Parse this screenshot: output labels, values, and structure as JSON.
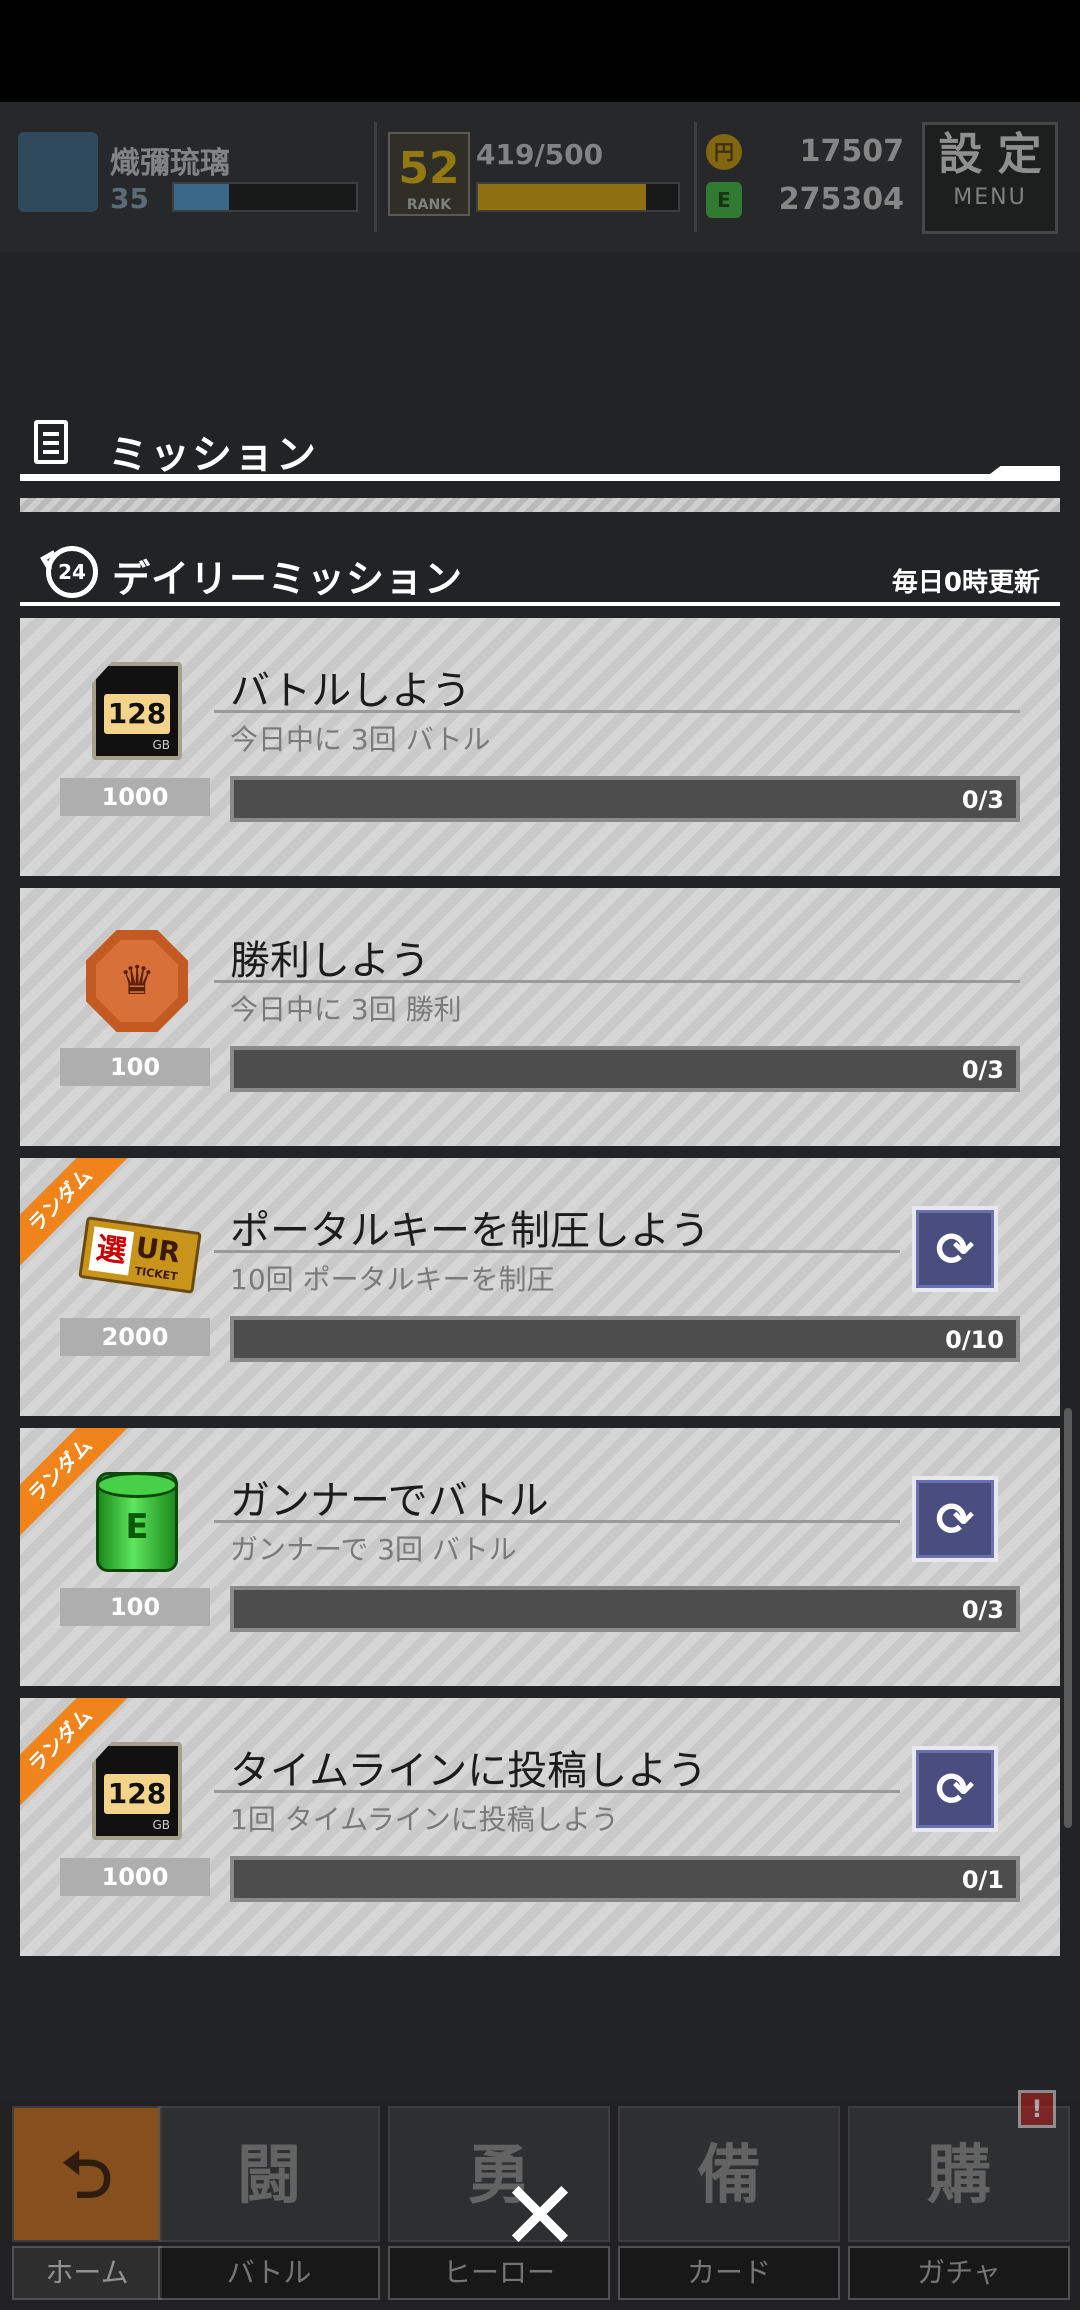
{
  "header": {
    "player_name": "熾彌琉璃",
    "level": "35",
    "level_progress": 0.3,
    "rank": "52",
    "rank_label": "RANK",
    "exp": "419/500",
    "exp_progress": 0.838,
    "gold_coins": "17507",
    "green_coins": "275304",
    "menu_kanji": "設 定",
    "menu_label": "MENU",
    "gold_icon_glyph": "円",
    "green_icon_glyph": "E"
  },
  "mission_panel": {
    "title": "ミッション",
    "section_title": "デイリーミッション",
    "section_icon_text": "24",
    "reset_note": "毎日0時更新"
  },
  "missions": [
    {
      "title": "バトルしよう",
      "description": "今日中に 3回 バトル",
      "reward_icon": "memory-128gb-icon",
      "reward_icon_text": "128",
      "reward_icon_sub": "GB",
      "reward_count": "1000",
      "progress_text": "0/3",
      "progress": 0,
      "random": false
    },
    {
      "title": "勝利しよう",
      "description": "今日中に 3回 勝利",
      "reward_icon": "bronze-medal-icon",
      "reward_icon_text": "♛",
      "reward_count": "100",
      "progress_text": "0/3",
      "progress": 0,
      "random": false
    },
    {
      "title": "ポータルキーを制圧しよう",
      "description": "10回 ポータルキーを制圧",
      "reward_icon": "ur-ticket-icon",
      "reward_icon_text": "UR",
      "reward_icon_kanji": "選",
      "reward_icon_sub": "TICKET",
      "reward_count": "2000",
      "progress_text": "0/10",
      "progress": 0,
      "random": true
    },
    {
      "title": "ガンナーでバトル",
      "description": "ガンナーで 3回 バトル",
      "reward_icon": "green-barrel-icon",
      "reward_icon_text": "E",
      "reward_count": "100",
      "progress_text": "0/3",
      "progress": 0,
      "random": true
    },
    {
      "title": "タイムラインに投稿しよう",
      "description": "1回 タイムラインに投稿しよう",
      "reward_icon": "memory-128gb-icon",
      "reward_icon_text": "128",
      "reward_icon_sub": "GB",
      "reward_count": "1000",
      "progress_text": "0/1",
      "progress": 0,
      "random": true
    }
  ],
  "random_ribbon_label": "ランダム",
  "refresh_icon": "refresh-icon",
  "bottom_nav": {
    "items": [
      {
        "label": "ホーム",
        "icon": "home-return-icon",
        "icon_text": "⮌"
      },
      {
        "label": "バトル",
        "icon": "battle-icon",
        "icon_text": "闘"
      },
      {
        "label": "ヒーロー",
        "icon": "hero-icon",
        "icon_text": "勇"
      },
      {
        "label": "カード",
        "icon": "card-icon",
        "icon_text": "備"
      },
      {
        "label": "ガチャ",
        "icon": "gacha-icon",
        "icon_text": "購"
      }
    ],
    "alert_text": "!"
  },
  "close_glyph": "✕",
  "colors": {
    "accent_orange": "#f0841a",
    "progress_fill": "#e5b100",
    "refresh_bg": "#4a4e7e"
  }
}
